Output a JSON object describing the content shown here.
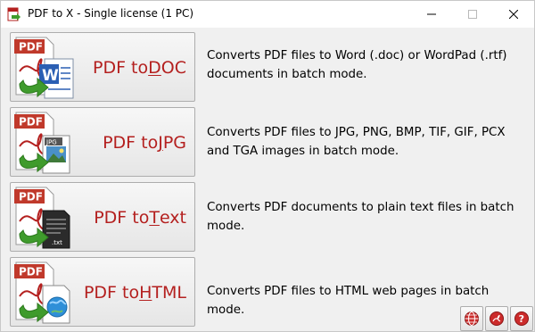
{
  "window": {
    "title": "PDF to X - Single license (1 PC)",
    "controls": {
      "minimize": "minimize-icon",
      "maximize": "maximize-icon",
      "close": "close-icon"
    }
  },
  "converters": [
    {
      "prefix": "PDF to ",
      "mnemonic": "D",
      "suffix": "OC",
      "badge": "PDF",
      "icon": "pdf-to-word-icon",
      "description": "Converts PDF files to Word (.doc) or WordPad (.rtf) documents in batch mode."
    },
    {
      "prefix": "PDF to ",
      "mnemonic": "J",
      "suffix": "PG",
      "badge": "PDF",
      "file_tag": "JPG",
      "icon": "pdf-to-jpg-icon",
      "description": "Converts PDF files to JPG, PNG, BMP, TIF, GIF, PCX and TGA images in batch mode."
    },
    {
      "prefix": "PDF to ",
      "mnemonic": "T",
      "suffix": "ext",
      "badge": "PDF",
      "file_tag": ".txt",
      "icon": "pdf-to-text-icon",
      "description": "Converts PDF documents to plain text files in batch mode."
    },
    {
      "prefix": "PDF to ",
      "mnemonic": "H",
      "suffix": "TML",
      "badge": "PDF",
      "icon": "pdf-to-html-icon",
      "description": "Converts PDF files to HTML web pages in batch mode."
    }
  ],
  "toolbar": {
    "buttons": [
      "globe-icon",
      "pdf-settings-icon",
      "help-icon"
    ]
  },
  "colors": {
    "accent_red": "#b4201f",
    "arrow_green": "#3f9b2c",
    "button_face": "#e6e6e6"
  }
}
